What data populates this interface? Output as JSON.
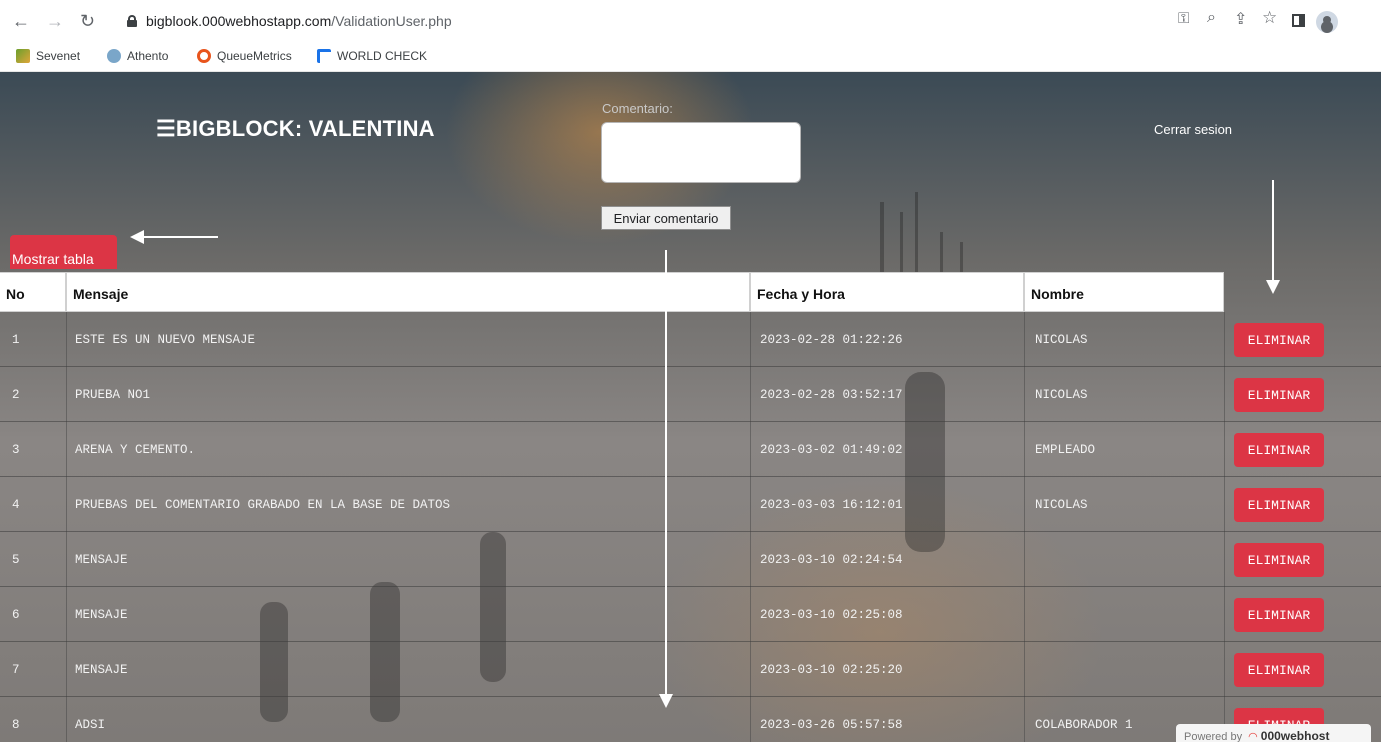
{
  "browser": {
    "url_host": "bigblook.000webhostapp.com",
    "url_path": "/ValidationUser.php",
    "bookmarks": [
      "Sevenet",
      "Athento",
      "QueueMetrics",
      "WORLD CHECK"
    ]
  },
  "header": {
    "brand": "☰BIGBLOCK: VALENTINA",
    "comment_label": "Comentario:",
    "comment_value": "",
    "send_label": "Enviar comentario",
    "logout_label": "Cerrar sesion",
    "show_table_label": "Mostrar tabla"
  },
  "table": {
    "columns": [
      "No",
      "Mensaje",
      "Fecha y Hora",
      "Nombre"
    ],
    "delete_label": "ELIMINAR",
    "rows": [
      {
        "no": "1",
        "mensaje": "ESTE ES UN NUEVO MENSAJE",
        "fecha": "2023-02-28 01:22:26",
        "nombre": "NICOLAS"
      },
      {
        "no": "2",
        "mensaje": "PRUEBA NO1",
        "fecha": "2023-02-28 03:52:17",
        "nombre": "NICOLAS"
      },
      {
        "no": "3",
        "mensaje": "ARENA Y CEMENTO.",
        "fecha": "2023-03-02 01:49:02",
        "nombre": "EMPLEADO"
      },
      {
        "no": "4",
        "mensaje": "PRUEBAS DEL COMENTARIO GRABADO EN LA BASE DE DATOS",
        "fecha": "2023-03-03 16:12:01",
        "nombre": "NICOLAS"
      },
      {
        "no": "5",
        "mensaje": "MENSAJE",
        "fecha": "2023-03-10 02:24:54",
        "nombre": ""
      },
      {
        "no": "6",
        "mensaje": "MENSAJE",
        "fecha": "2023-03-10 02:25:08",
        "nombre": ""
      },
      {
        "no": "7",
        "mensaje": "MENSAJE",
        "fecha": "2023-03-10 02:25:20",
        "nombre": ""
      },
      {
        "no": "8",
        "mensaje": "ADSI",
        "fecha": "2023-03-26 05:57:58",
        "nombre": "COLABORADOR 1"
      }
    ]
  },
  "footer": {
    "powered_by": "Powered by",
    "powered_brand": "000webhost"
  },
  "colors": {
    "accent_red": "#dc3545"
  }
}
